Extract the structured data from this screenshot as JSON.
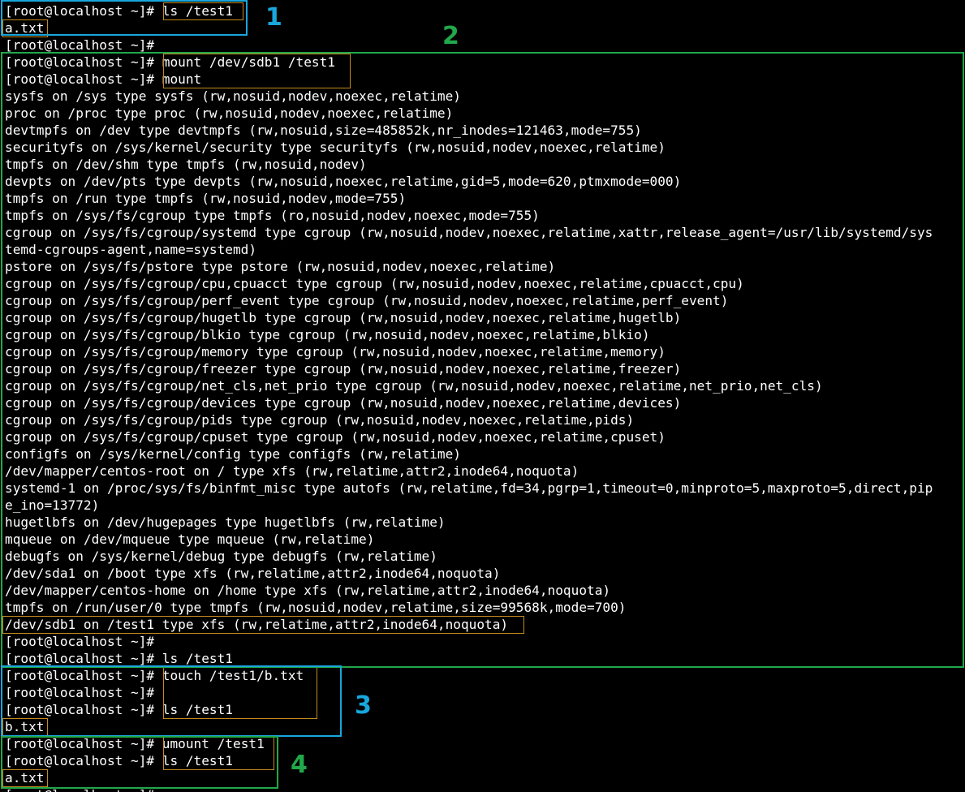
{
  "prompt": "[root@localhost ~]# ",
  "lines": [
    {
      "cmd": "ls /test1"
    },
    {
      "out": "a.txt"
    },
    {
      "cmd": ""
    },
    {
      "cmd": "mount /dev/sdb1 /test1"
    },
    {
      "cmd": "mount"
    },
    {
      "out": "sysfs on /sys type sysfs (rw,nosuid,nodev,noexec,relatime)"
    },
    {
      "out": "proc on /proc type proc (rw,nosuid,nodev,noexec,relatime)"
    },
    {
      "out": "devtmpfs on /dev type devtmpfs (rw,nosuid,size=485852k,nr_inodes=121463,mode=755)"
    },
    {
      "out": "securityfs on /sys/kernel/security type securityfs (rw,nosuid,nodev,noexec,relatime)"
    },
    {
      "out": "tmpfs on /dev/shm type tmpfs (rw,nosuid,nodev)"
    },
    {
      "out": "devpts on /dev/pts type devpts (rw,nosuid,noexec,relatime,gid=5,mode=620,ptmxmode=000)"
    },
    {
      "out": "tmpfs on /run type tmpfs (rw,nosuid,nodev,mode=755)"
    },
    {
      "out": "tmpfs on /sys/fs/cgroup type tmpfs (ro,nosuid,nodev,noexec,mode=755)"
    },
    {
      "out": "cgroup on /sys/fs/cgroup/systemd type cgroup (rw,nosuid,nodev,noexec,relatime,xattr,release_agent=/usr/lib/systemd/sys"
    },
    {
      "out": "temd-cgroups-agent,name=systemd)"
    },
    {
      "out": "pstore on /sys/fs/pstore type pstore (rw,nosuid,nodev,noexec,relatime)"
    },
    {
      "out": "cgroup on /sys/fs/cgroup/cpu,cpuacct type cgroup (rw,nosuid,nodev,noexec,relatime,cpuacct,cpu)"
    },
    {
      "out": "cgroup on /sys/fs/cgroup/perf_event type cgroup (rw,nosuid,nodev,noexec,relatime,perf_event)"
    },
    {
      "out": "cgroup on /sys/fs/cgroup/hugetlb type cgroup (rw,nosuid,nodev,noexec,relatime,hugetlb)"
    },
    {
      "out": "cgroup on /sys/fs/cgroup/blkio type cgroup (rw,nosuid,nodev,noexec,relatime,blkio)"
    },
    {
      "out": "cgroup on /sys/fs/cgroup/memory type cgroup (rw,nosuid,nodev,noexec,relatime,memory)"
    },
    {
      "out": "cgroup on /sys/fs/cgroup/freezer type cgroup (rw,nosuid,nodev,noexec,relatime,freezer)"
    },
    {
      "out": "cgroup on /sys/fs/cgroup/net_cls,net_prio type cgroup (rw,nosuid,nodev,noexec,relatime,net_prio,net_cls)"
    },
    {
      "out": "cgroup on /sys/fs/cgroup/devices type cgroup (rw,nosuid,nodev,noexec,relatime,devices)"
    },
    {
      "out": "cgroup on /sys/fs/cgroup/pids type cgroup (rw,nosuid,nodev,noexec,relatime,pids)"
    },
    {
      "out": "cgroup on /sys/fs/cgroup/cpuset type cgroup (rw,nosuid,nodev,noexec,relatime,cpuset)"
    },
    {
      "out": "configfs on /sys/kernel/config type configfs (rw,relatime)"
    },
    {
      "out": "/dev/mapper/centos-root on / type xfs (rw,relatime,attr2,inode64,noquota)"
    },
    {
      "out": "systemd-1 on /proc/sys/fs/binfmt_misc type autofs (rw,relatime,fd=34,pgrp=1,timeout=0,minproto=5,maxproto=5,direct,pip"
    },
    {
      "out": "e_ino=13772)"
    },
    {
      "out": "hugetlbfs on /dev/hugepages type hugetlbfs (rw,relatime)"
    },
    {
      "out": "mqueue on /dev/mqueue type mqueue (rw,relatime)"
    },
    {
      "out": "debugfs on /sys/kernel/debug type debugfs (rw,relatime)"
    },
    {
      "out": "/dev/sda1 on /boot type xfs (rw,relatime,attr2,inode64,noquota)"
    },
    {
      "out": "/dev/mapper/centos-home on /home type xfs (rw,relatime,attr2,inode64,noquota)"
    },
    {
      "out": "tmpfs on /run/user/0 type tmpfs (rw,nosuid,nodev,relatime,size=99568k,mode=700)"
    },
    {
      "out": "/dev/sdb1 on /test1 type xfs (rw,relatime,attr2,inode64,noquota)"
    },
    {
      "cmd": ""
    },
    {
      "cmd": "ls /test1"
    },
    {
      "cmd": "touch /test1/b.txt"
    },
    {
      "cmd": ""
    },
    {
      "cmd": "ls /test1"
    },
    {
      "out": "b.txt"
    },
    {
      "cmd": "umount /test1"
    },
    {
      "cmd": "ls /test1"
    },
    {
      "out": "a.txt"
    },
    {
      "cmd": ""
    }
  ],
  "annotations": [
    {
      "label": "1",
      "color": "#18a7dd"
    },
    {
      "label": "2",
      "color": "#21a84a"
    },
    {
      "label": "3",
      "color": "#18a7dd"
    },
    {
      "label": "4",
      "color": "#21a84a"
    }
  ],
  "colors": {
    "background": "#000000",
    "text": "#ffffff",
    "highlight": "#c58a1d",
    "blue": "#18a7dd",
    "green": "#21a84a"
  }
}
